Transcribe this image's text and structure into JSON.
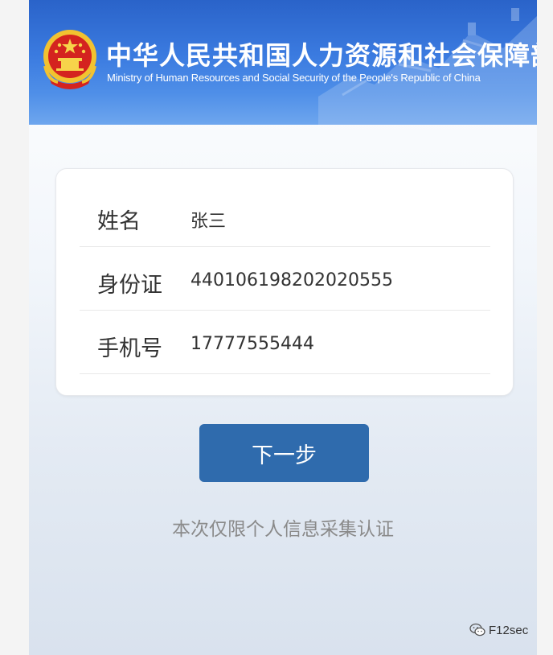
{
  "header": {
    "title_cn": "中华人民共和国人力资源和社会保障部",
    "title_en": "Ministry of Human Resources and Social Security of the People's Republic of China",
    "emblem_icon": "national-emblem-icon",
    "colors": {
      "bg_top": "#2a63c9",
      "bg_bottom": "#6ea6ee"
    }
  },
  "form": {
    "rows": [
      {
        "label": "姓名",
        "value": "张三"
      },
      {
        "label": "身份证",
        "value": "440106198202020555"
      },
      {
        "label": "手机号",
        "value": "17777555444"
      }
    ]
  },
  "actions": {
    "next_label": "下一步",
    "button_color": "#2f6bad"
  },
  "notice": "本次仅限个人信息采集认证",
  "watermark": {
    "icon": "wechat-icon",
    "text": "F12sec"
  }
}
